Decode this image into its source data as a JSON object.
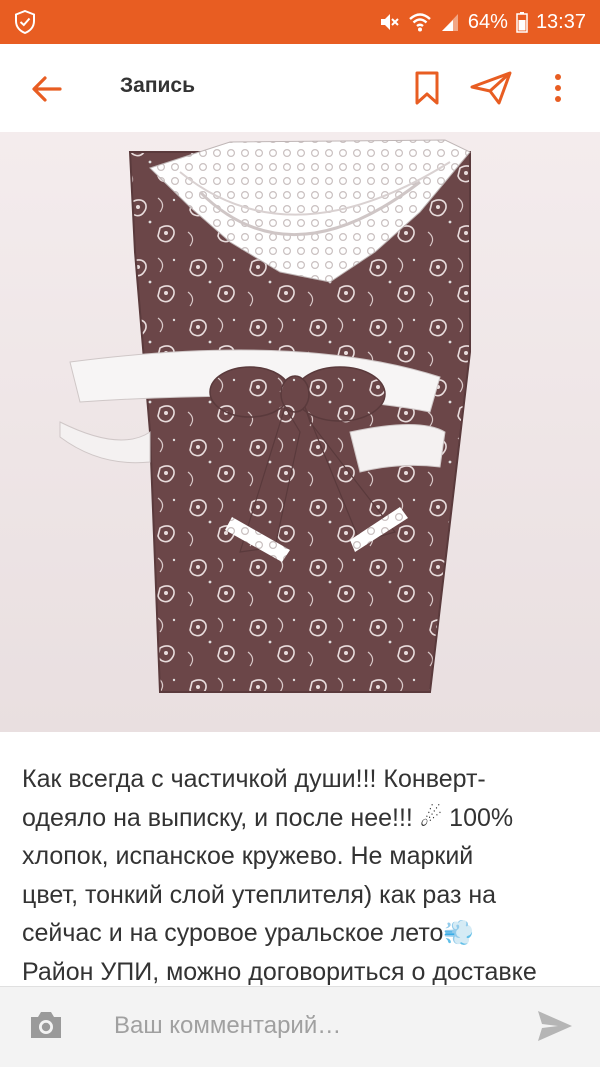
{
  "status_bar": {
    "battery": "64%",
    "time": "13:37",
    "icons": [
      "shield-check-icon",
      "mute-icon",
      "wifi-icon",
      "signal-icon",
      "battery-icon"
    ]
  },
  "header": {
    "title": "Запись",
    "icons": [
      "arrow-left-icon",
      "bookmark-icon",
      "share-icon",
      "more-vertical-icon"
    ]
  },
  "post": {
    "image_alt": "photo",
    "text": "Как всегда с частичкой души!!! Конверт-\nодеяло на выписку, и после нее!!! ☄ 100%\nхлопок, испанское кружево. Не маркий\nцвет, тонкий слой утеплителя) как раз на\nсейчас и на суровое уральское лето💨\nРайон УПИ, можно договориться о доставке"
  },
  "comment": {
    "placeholder": "Ваш комментарий…",
    "icons": [
      "camera-icon",
      "send-icon"
    ]
  },
  "colors": {
    "accent": "#e85d22",
    "fabric": "#6b4648",
    "lace": "#ffffff",
    "bed": "#efe6e7",
    "comment_bar_bg": "#f3f3f3"
  }
}
